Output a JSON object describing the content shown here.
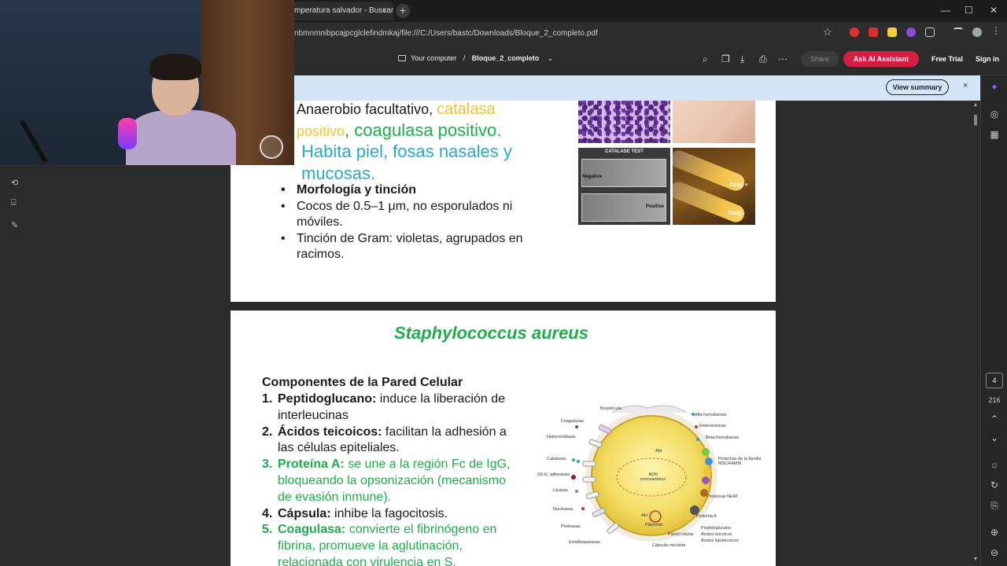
{
  "browser": {
    "tab_title": "mperatura salvador - Buscar",
    "tab_close": "×",
    "new_tab": "+",
    "url": "nbmnmnibpcajpcglclefindmkaj/file:///C:/Users/bastc/Downloads/Bloque_2_completo.pdf",
    "win_min": "—",
    "win_max": "☐",
    "win_close": "✕"
  },
  "viewer": {
    "location": "Your computer",
    "separator": "/",
    "file_name": "Bloque_2_completo",
    "share_label": "Share",
    "ai_label": "Ask AI Assistant",
    "trial_label": "Free Trial",
    "signin_label": "Sign in",
    "summary_label": "View summary",
    "banner_close": "×",
    "page_current": "4",
    "page_total": "216"
  },
  "page1": {
    "line1_a": "Anaerobio facultativo, ",
    "line1_b": "catalasa",
    "line2_a": "positivo",
    "line2_b": ", coagulasa positivo.",
    "line3": "Habita piel, fosas nasales y",
    "line4": "mucosas.",
    "bullets": [
      "Morfología y tinción",
      "Cocos de 0.5–1 μm, no esporulados ni móviles.",
      "Tinción de Gram: violetas, agrupados en racimos."
    ],
    "catalase_title": "CATALASE TEST",
    "catalase_negative": "Negative",
    "catalase_positive": "Positive",
    "coag_pos": "Coag +",
    "coag_neg": "Coag -"
  },
  "page2": {
    "title": "Staphylococcus aureus",
    "heading": "Componentes de la Pared Celular",
    "items": [
      {
        "num": "1.",
        "term": "Peptidoglucano:",
        "text": " induce la liberación de interleucinas"
      },
      {
        "num": "2.",
        "term": "Ácidos teicoicos:",
        "text": " facilitan la adhesión a las células epiteliales."
      },
      {
        "num": "3.",
        "term": "Proteína A:",
        "text": " se une a la región Fc de IgG, bloqueando la opsonización (mecanismo de evasión inmune)."
      },
      {
        "num": "4.",
        "term": "Cápsula:",
        "text": " inhibe la fagocitosis."
      },
      {
        "num": "5.",
        "term": "Coagulasa:",
        "text": " convierte el fibrinógeno en fibrina, promueve la aglutinación, relacionada con virulencia en S."
      }
    ],
    "diagram_labels": {
      "biopelicula": "Biopelícula",
      "coagulasas": "Coagulasas",
      "hialuronidasas": "Hialuronidasas",
      "catalasas": "Catalasas",
      "adhesinas": "G5-E: adhesinas",
      "lipasas": "Lipasas",
      "nucleasas": "Nucleasas",
      "proteasas": "Proteasas",
      "estafiloquinasas": "Estafiloquinasas",
      "alfa": "Alfa-hemolisinas",
      "enterotoxinas": "Enterotoxinas",
      "beta": "Beta-hemolisinas",
      "mscramm": "Proteínas de la familia MSCRAMM",
      "neat": "Proteínas NEAT",
      "proteina_a": "Proteína A",
      "pared": "Pared celular",
      "peptidoglucano": "Peptidoglucano",
      "teicoicos": "Ácidos teicoicos",
      "lipoteicoicos": "Ácidos lipoteicoicos",
      "capsula": "Cápsula mucoide",
      "adn": "ADN cromosómico",
      "plasmido": "Plásmido",
      "abr1": "Abr",
      "abr2": "Abr"
    }
  },
  "colors": {
    "accent_green": "#1fad4b",
    "accent_yellow": "#f1c232",
    "accent_cyan": "#29a8d6",
    "ai_button": "#d61e45",
    "banner": "#d2e6f8"
  }
}
